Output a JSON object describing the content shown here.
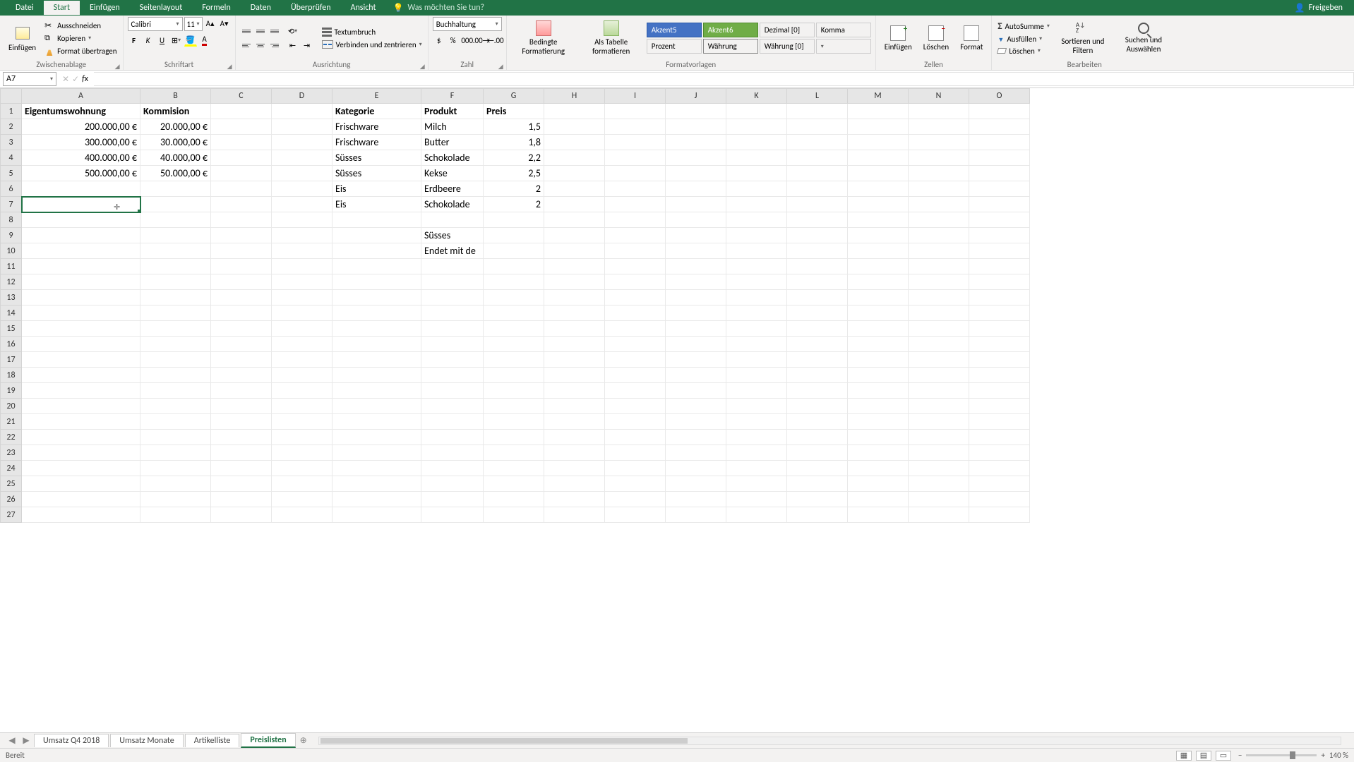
{
  "titlebar": {
    "tabs": [
      "Datei",
      "Start",
      "Einfügen",
      "Seitenlayout",
      "Formeln",
      "Daten",
      "Überprüfen",
      "Ansicht"
    ],
    "active_tab": 1,
    "tellme_placeholder": "Was möchten Sie tun?",
    "share": "Freigeben"
  },
  "ribbon": {
    "clipboard": {
      "paste": "Einfügen",
      "cut": "Ausschneiden",
      "copy": "Kopieren",
      "format_painter": "Format übertragen",
      "group": "Zwischenablage"
    },
    "font": {
      "name": "Calibri",
      "size": "11",
      "group": "Schriftart"
    },
    "alignment": {
      "wrap": "Textumbruch",
      "merge": "Verbinden und zentrieren",
      "group": "Ausrichtung"
    },
    "number": {
      "format": "Buchhaltung",
      "group": "Zahl"
    },
    "styles": {
      "cond": "Bedingte Formatierung",
      "as_table": "Als Tabelle formatieren",
      "akzent5": "Akzent5",
      "akzent6": "Akzent6",
      "dezimal": "Dezimal [0]",
      "komma": "Komma",
      "prozent": "Prozent",
      "waehrung": "Währung",
      "waehrung0": "Währung [0]",
      "group": "Formatvorlagen"
    },
    "cells": {
      "insert": "Einfügen",
      "delete": "Löschen",
      "format": "Format",
      "group": "Zellen"
    },
    "editing": {
      "autosum": "AutoSumme",
      "fill": "Ausfüllen",
      "clear": "Löschen",
      "sort": "Sortieren und Filtern",
      "find": "Suchen und Auswählen",
      "group": "Bearbeiten"
    }
  },
  "name_box": "A7",
  "formula": "",
  "columns": [
    "A",
    "B",
    "C",
    "D",
    "E",
    "F",
    "G",
    "H",
    "I",
    "J",
    "K",
    "L",
    "M",
    "N",
    "O"
  ],
  "rows": {
    "1": {
      "A": "Eigentumswohnung",
      "B": "Kommision",
      "E": "Kategorie",
      "F": "Produkt",
      "G": "Preis"
    },
    "2": {
      "A": "200.000,00 €",
      "B": "20.000,00 €",
      "E": "Frischware",
      "F": "Milch",
      "G": "1,5"
    },
    "3": {
      "A": "300.000,00 €",
      "B": "30.000,00 €",
      "E": "Frischware",
      "F": "Butter",
      "G": "1,8"
    },
    "4": {
      "A": "400.000,00 €",
      "B": "40.000,00 €",
      "E": "Süsses",
      "F": "Schokolade",
      "G": "2,2"
    },
    "5": {
      "A": "500.000,00 €",
      "B": "50.000,00 €",
      "E": "Süsses",
      "F": "Kekse",
      "G": "2,5"
    },
    "6": {
      "E": "Eis",
      "F": "Erdbeere",
      "G": "2"
    },
    "7": {
      "E": "Eis",
      "F": "Schokolade",
      "G": "2"
    },
    "9": {
      "F": "Süsses"
    },
    "10": {
      "F": "Endet mit de"
    }
  },
  "sheet_tabs": [
    "Umsatz Q4 2018",
    "Umsatz Monate",
    "Artikelliste",
    "Preislisten"
  ],
  "active_sheet": 3,
  "statusbar": {
    "ready": "Bereit",
    "zoom": "140 %"
  }
}
